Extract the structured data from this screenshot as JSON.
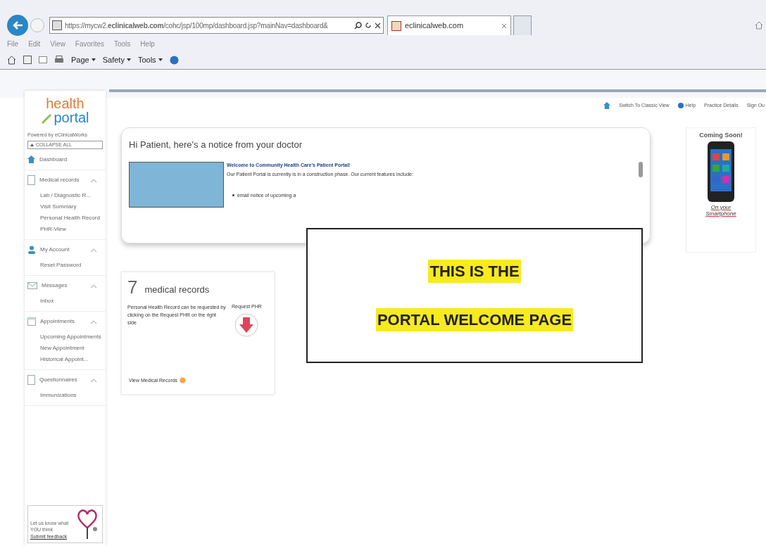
{
  "browser": {
    "url": "https://mycw2.**eclinicalweb.com**/cohc/jsp/100mp/dashboard.jsp?mainNav=dashboard&",
    "tabs": [
      {
        "label": "eclinicalweb.com",
        "selected": true
      }
    ],
    "menu": [
      "File",
      "Edit",
      "View",
      "Favorites",
      "Tools",
      "Help"
    ],
    "toolbar": [
      "Page",
      "Safety",
      "Tools"
    ]
  },
  "sidebar": {
    "logo_top": "health",
    "logo_bottom": "portal",
    "powered_by": "Powered by eClinicalWorks",
    "collapse_all": "COLLAPSE ALL",
    "dashboard": "Dashboard",
    "sections": [
      {
        "label": "Medical records",
        "expanded": true,
        "children": [
          "Lab / Diagnostic R...",
          "Visit Summary",
          "Personal Health Record",
          "PHR-View"
        ]
      },
      {
        "label": "My Account",
        "expanded": true,
        "children": [
          "Reset Password"
        ]
      },
      {
        "label": "Messages",
        "expanded": true,
        "children": [
          "Inbox"
        ]
      },
      {
        "label": "Appointments",
        "expanded": true,
        "children": [
          "Upcoming Appointments",
          "New Appointment",
          "Historical Appoint..."
        ]
      },
      {
        "label": "Questionnaires",
        "expanded": true,
        "children": [
          "Immunizations"
        ]
      }
    ],
    "feedback": {
      "text": "Let us know what YOU think",
      "link": "Submit feedback"
    }
  },
  "top_links": [
    "Switch To Classic View",
    "Help",
    "Practice Details",
    "Sign Ou"
  ],
  "notice": {
    "title": "Hi Patient, here's a notice from your doctor",
    "headline": "Welcome to Community Health Care's Patient Portal!",
    "body": "Our Patient Portal is currently is in a construction phase. Our current features include:",
    "bullets": [
      "email notice of upcoming a"
    ]
  },
  "records": {
    "count": "7",
    "title": "medical records",
    "text": "Personal Health Record can be requested by clicking on the Request PHR on the right side",
    "request": "Request PHR",
    "view": "View Medical Records"
  },
  "promo": {
    "title": "Coming Soon!",
    "caption": "On your Smartphone"
  },
  "annotation": [
    "THIS IS THE",
    "PORTAL WELCOME PAGE"
  ]
}
